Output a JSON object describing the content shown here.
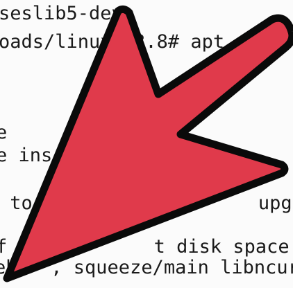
{
  "terminal": {
    "lines": [
      "seslib5-dev",
      "oads/linux  3.8# apt",
      "e",
      "e ins",
      " to                    upgrad",
      "",
      "f             t disk space will",
      "eb   , squeeze/main libncurs"
    ]
  },
  "overlay": {
    "icon": "pointer-arrow-icon",
    "fill_color": "#e03a4b",
    "stroke_color": "#0a0a0a"
  }
}
